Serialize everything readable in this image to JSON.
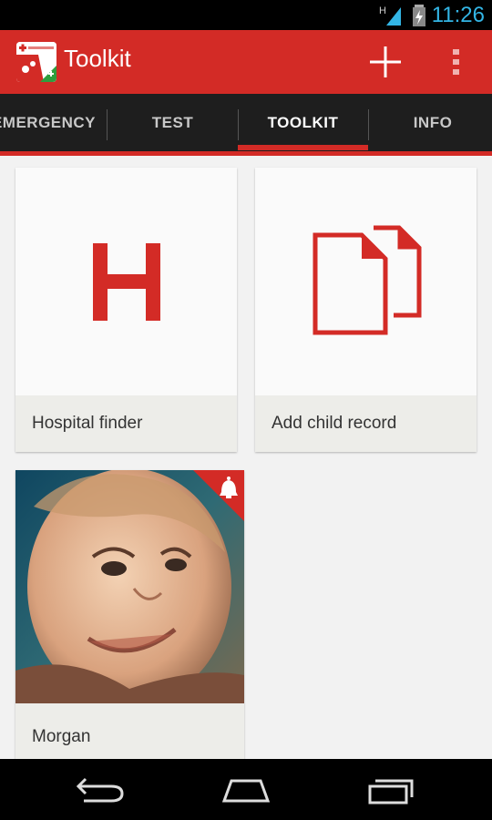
{
  "status": {
    "time": "11:26",
    "network": "H"
  },
  "appbar": {
    "title": "Toolkit"
  },
  "tabs": [
    {
      "label": "EMERGENCY",
      "active": false
    },
    {
      "label": "TEST",
      "active": false
    },
    {
      "label": "TOOLKIT",
      "active": true
    },
    {
      "label": "INFO",
      "active": false
    }
  ],
  "cards": [
    {
      "label": "Hospital finder",
      "icon": "hospital-h-icon"
    },
    {
      "label": "Add child record",
      "icon": "document-copy-icon"
    },
    {
      "label": "Morgan",
      "icon": "child-photo",
      "badge": "bell-icon"
    }
  ],
  "colors": {
    "accent": "#d32b26",
    "tabbar": "#1e1e1e",
    "status": "#33b5e5"
  }
}
